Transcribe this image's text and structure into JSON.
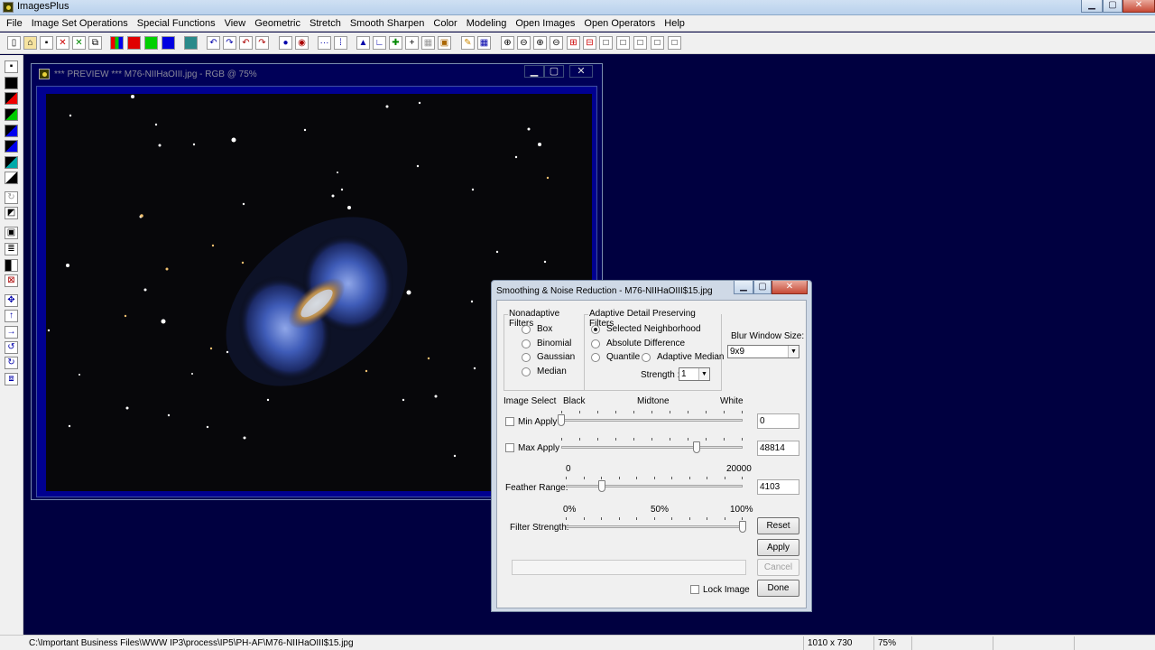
{
  "app": {
    "title": "ImagesPlus"
  },
  "menu": [
    "File",
    "Image Set Operations",
    "Special Functions",
    "View",
    "Geometric",
    "Stretch",
    "Smooth Sharpen",
    "Color",
    "Modeling",
    "Open Images",
    "Open Operators",
    "Help"
  ],
  "preview": {
    "title": "*** PREVIEW *** M76-NIIHaOIII.jpg - RGB @ 75%"
  },
  "dialog": {
    "title": "Smoothing & Noise Reduction - M76-NIIHaOIII$15.jpg",
    "nonadaptive": {
      "label": "Nonadaptive Filters",
      "options": [
        "Box",
        "Binomial",
        "Gaussian",
        "Median"
      ]
    },
    "adaptive": {
      "label": "Adaptive Detail Preserving Filters",
      "selected_neighborhood": "Selected Neighborhood",
      "absolute_difference": "Absolute Difference",
      "quantile": "Quantile",
      "adaptive_median": "Adaptive Median",
      "strength_label": "Strength :",
      "strength_value": "1"
    },
    "blur": {
      "label": "Blur Window Size:",
      "value": "9x9"
    },
    "image_select": {
      "label": "Image Select",
      "black": "Black",
      "midtone": "Midtone",
      "white": "White"
    },
    "min_apply": {
      "label": "Min Apply",
      "value": "0",
      "fraction": 0.0
    },
    "max_apply": {
      "label": "Max Apply",
      "value": "48814",
      "fraction": 0.745
    },
    "feather": {
      "label": "Feather Range:",
      "min": "0",
      "max": "20000",
      "value": "4103",
      "fraction": 0.205
    },
    "filter_strength": {
      "label": "Filter Strength:",
      "t0": "0%",
      "t50": "50%",
      "t100": "100%",
      "fraction": 1.0
    },
    "buttons": {
      "reset": "Reset",
      "apply": "Apply",
      "cancel": "Cancel",
      "done": "Done"
    },
    "lock_image": "Lock Image"
  },
  "status": {
    "path": "C:\\Important Business Files\\WWW IP3\\process\\IP5\\PH-AF\\M76-NIIHaOIII$15.jpg",
    "dimensions": "1010 x 730",
    "zoom": "75%"
  },
  "colors": {
    "desktop": "#000040",
    "accent_red": "#e00000",
    "accent_green": "#00d000",
    "accent_blue": "#0000e0"
  }
}
